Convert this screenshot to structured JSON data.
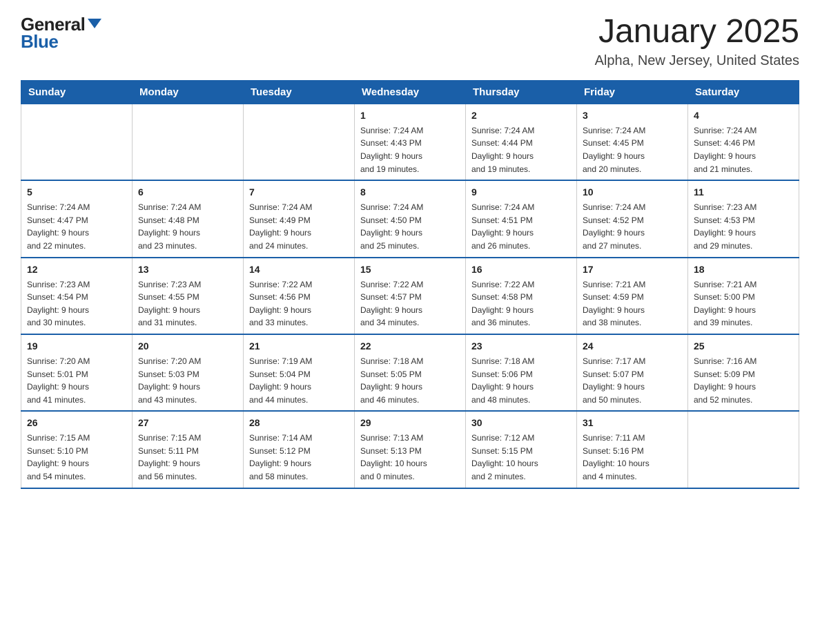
{
  "header": {
    "logo_general": "General",
    "logo_blue": "Blue",
    "month_title": "January 2025",
    "location": "Alpha, New Jersey, United States"
  },
  "days_of_week": [
    "Sunday",
    "Monday",
    "Tuesday",
    "Wednesday",
    "Thursday",
    "Friday",
    "Saturday"
  ],
  "weeks": [
    [
      {
        "day": "",
        "info": ""
      },
      {
        "day": "",
        "info": ""
      },
      {
        "day": "",
        "info": ""
      },
      {
        "day": "1",
        "info": "Sunrise: 7:24 AM\nSunset: 4:43 PM\nDaylight: 9 hours\nand 19 minutes."
      },
      {
        "day": "2",
        "info": "Sunrise: 7:24 AM\nSunset: 4:44 PM\nDaylight: 9 hours\nand 19 minutes."
      },
      {
        "day": "3",
        "info": "Sunrise: 7:24 AM\nSunset: 4:45 PM\nDaylight: 9 hours\nand 20 minutes."
      },
      {
        "day": "4",
        "info": "Sunrise: 7:24 AM\nSunset: 4:46 PM\nDaylight: 9 hours\nand 21 minutes."
      }
    ],
    [
      {
        "day": "5",
        "info": "Sunrise: 7:24 AM\nSunset: 4:47 PM\nDaylight: 9 hours\nand 22 minutes."
      },
      {
        "day": "6",
        "info": "Sunrise: 7:24 AM\nSunset: 4:48 PM\nDaylight: 9 hours\nand 23 minutes."
      },
      {
        "day": "7",
        "info": "Sunrise: 7:24 AM\nSunset: 4:49 PM\nDaylight: 9 hours\nand 24 minutes."
      },
      {
        "day": "8",
        "info": "Sunrise: 7:24 AM\nSunset: 4:50 PM\nDaylight: 9 hours\nand 25 minutes."
      },
      {
        "day": "9",
        "info": "Sunrise: 7:24 AM\nSunset: 4:51 PM\nDaylight: 9 hours\nand 26 minutes."
      },
      {
        "day": "10",
        "info": "Sunrise: 7:24 AM\nSunset: 4:52 PM\nDaylight: 9 hours\nand 27 minutes."
      },
      {
        "day": "11",
        "info": "Sunrise: 7:23 AM\nSunset: 4:53 PM\nDaylight: 9 hours\nand 29 minutes."
      }
    ],
    [
      {
        "day": "12",
        "info": "Sunrise: 7:23 AM\nSunset: 4:54 PM\nDaylight: 9 hours\nand 30 minutes."
      },
      {
        "day": "13",
        "info": "Sunrise: 7:23 AM\nSunset: 4:55 PM\nDaylight: 9 hours\nand 31 minutes."
      },
      {
        "day": "14",
        "info": "Sunrise: 7:22 AM\nSunset: 4:56 PM\nDaylight: 9 hours\nand 33 minutes."
      },
      {
        "day": "15",
        "info": "Sunrise: 7:22 AM\nSunset: 4:57 PM\nDaylight: 9 hours\nand 34 minutes."
      },
      {
        "day": "16",
        "info": "Sunrise: 7:22 AM\nSunset: 4:58 PM\nDaylight: 9 hours\nand 36 minutes."
      },
      {
        "day": "17",
        "info": "Sunrise: 7:21 AM\nSunset: 4:59 PM\nDaylight: 9 hours\nand 38 minutes."
      },
      {
        "day": "18",
        "info": "Sunrise: 7:21 AM\nSunset: 5:00 PM\nDaylight: 9 hours\nand 39 minutes."
      }
    ],
    [
      {
        "day": "19",
        "info": "Sunrise: 7:20 AM\nSunset: 5:01 PM\nDaylight: 9 hours\nand 41 minutes."
      },
      {
        "day": "20",
        "info": "Sunrise: 7:20 AM\nSunset: 5:03 PM\nDaylight: 9 hours\nand 43 minutes."
      },
      {
        "day": "21",
        "info": "Sunrise: 7:19 AM\nSunset: 5:04 PM\nDaylight: 9 hours\nand 44 minutes."
      },
      {
        "day": "22",
        "info": "Sunrise: 7:18 AM\nSunset: 5:05 PM\nDaylight: 9 hours\nand 46 minutes."
      },
      {
        "day": "23",
        "info": "Sunrise: 7:18 AM\nSunset: 5:06 PM\nDaylight: 9 hours\nand 48 minutes."
      },
      {
        "day": "24",
        "info": "Sunrise: 7:17 AM\nSunset: 5:07 PM\nDaylight: 9 hours\nand 50 minutes."
      },
      {
        "day": "25",
        "info": "Sunrise: 7:16 AM\nSunset: 5:09 PM\nDaylight: 9 hours\nand 52 minutes."
      }
    ],
    [
      {
        "day": "26",
        "info": "Sunrise: 7:15 AM\nSunset: 5:10 PM\nDaylight: 9 hours\nand 54 minutes."
      },
      {
        "day": "27",
        "info": "Sunrise: 7:15 AM\nSunset: 5:11 PM\nDaylight: 9 hours\nand 56 minutes."
      },
      {
        "day": "28",
        "info": "Sunrise: 7:14 AM\nSunset: 5:12 PM\nDaylight: 9 hours\nand 58 minutes."
      },
      {
        "day": "29",
        "info": "Sunrise: 7:13 AM\nSunset: 5:13 PM\nDaylight: 10 hours\nand 0 minutes."
      },
      {
        "day": "30",
        "info": "Sunrise: 7:12 AM\nSunset: 5:15 PM\nDaylight: 10 hours\nand 2 minutes."
      },
      {
        "day": "31",
        "info": "Sunrise: 7:11 AM\nSunset: 5:16 PM\nDaylight: 10 hours\nand 4 minutes."
      },
      {
        "day": "",
        "info": ""
      }
    ]
  ]
}
